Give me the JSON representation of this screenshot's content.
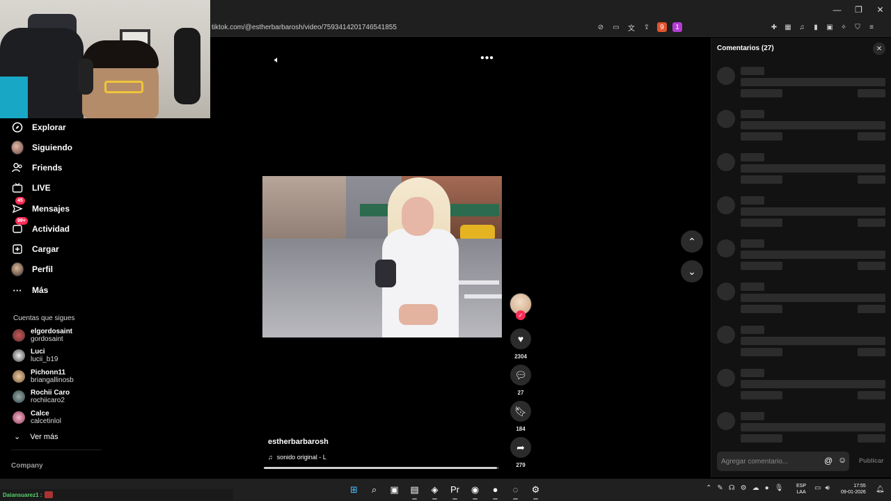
{
  "browser": {
    "url": "tiktok.com/@estherbarbarosh/video/7593414201746541855",
    "window_controls": [
      "—",
      "❐",
      "✕"
    ],
    "shield_badge": "9",
    "rewards_badge": "1"
  },
  "sidebar": {
    "nav": [
      {
        "label": "Explorar",
        "icon": "compass-icon"
      },
      {
        "label": "Siguiendo",
        "icon": "following-avatar"
      },
      {
        "label": "Friends",
        "icon": "friends-icon"
      },
      {
        "label": "LIVE",
        "icon": "live-tv-icon"
      },
      {
        "label": "Mensajes",
        "icon": "messages-icon",
        "badge": "45"
      },
      {
        "label": "Actividad",
        "icon": "activity-icon",
        "badge": "99+"
      },
      {
        "label": "Cargar",
        "icon": "upload-icon"
      },
      {
        "label": "Perfil",
        "icon": "profile-avatar"
      },
      {
        "label": "Más",
        "icon": "more-dots-icon"
      }
    ],
    "following_title": "Cuentas que sigues",
    "following": [
      {
        "name": "elgordosaint",
        "user": "gordosaint"
      },
      {
        "name": "Luci",
        "user": "lucii_b19"
      },
      {
        "name": "Pichonn11",
        "user": "briangallinosb"
      },
      {
        "name": "Rochii Caro",
        "user": "rochiicaro2"
      },
      {
        "name": "Calce",
        "user": "calcetinlol"
      }
    ],
    "see_more": "Ver más",
    "company": "Company"
  },
  "video": {
    "username": "estherbarbarosh",
    "sound": "sonido original - L",
    "progress": 0.99,
    "likes": "2304",
    "comments": "27",
    "saves": "184",
    "shares": "279"
  },
  "comments_panel": {
    "title": "Comentarios (27)",
    "placeholder": "Agregar comentario...",
    "publish": "Publicar",
    "skeleton_count": 9
  },
  "stream_chat": {
    "user": "Daiansuarez1 :"
  },
  "taskbar": {
    "apps": [
      {
        "name": "windows-start-icon",
        "glyph": "⊞"
      },
      {
        "name": "search-icon",
        "glyph": "⌕"
      },
      {
        "name": "photos-icon",
        "glyph": "▣"
      },
      {
        "name": "file-explorer-icon",
        "glyph": "▤"
      },
      {
        "name": "brave-browser-icon",
        "glyph": "◈"
      },
      {
        "name": "premiere-pro-icon",
        "glyph": "Pr"
      },
      {
        "name": "discord-icon",
        "glyph": "◉"
      },
      {
        "name": "spotify-icon",
        "glyph": "●"
      },
      {
        "name": "app-icon",
        "glyph": "◌"
      },
      {
        "name": "steam-icon",
        "glyph": "⚙"
      }
    ],
    "lang_line1": "ESP",
    "lang_line2": "LAA",
    "time": "17:55",
    "date": "09-01-2026"
  }
}
